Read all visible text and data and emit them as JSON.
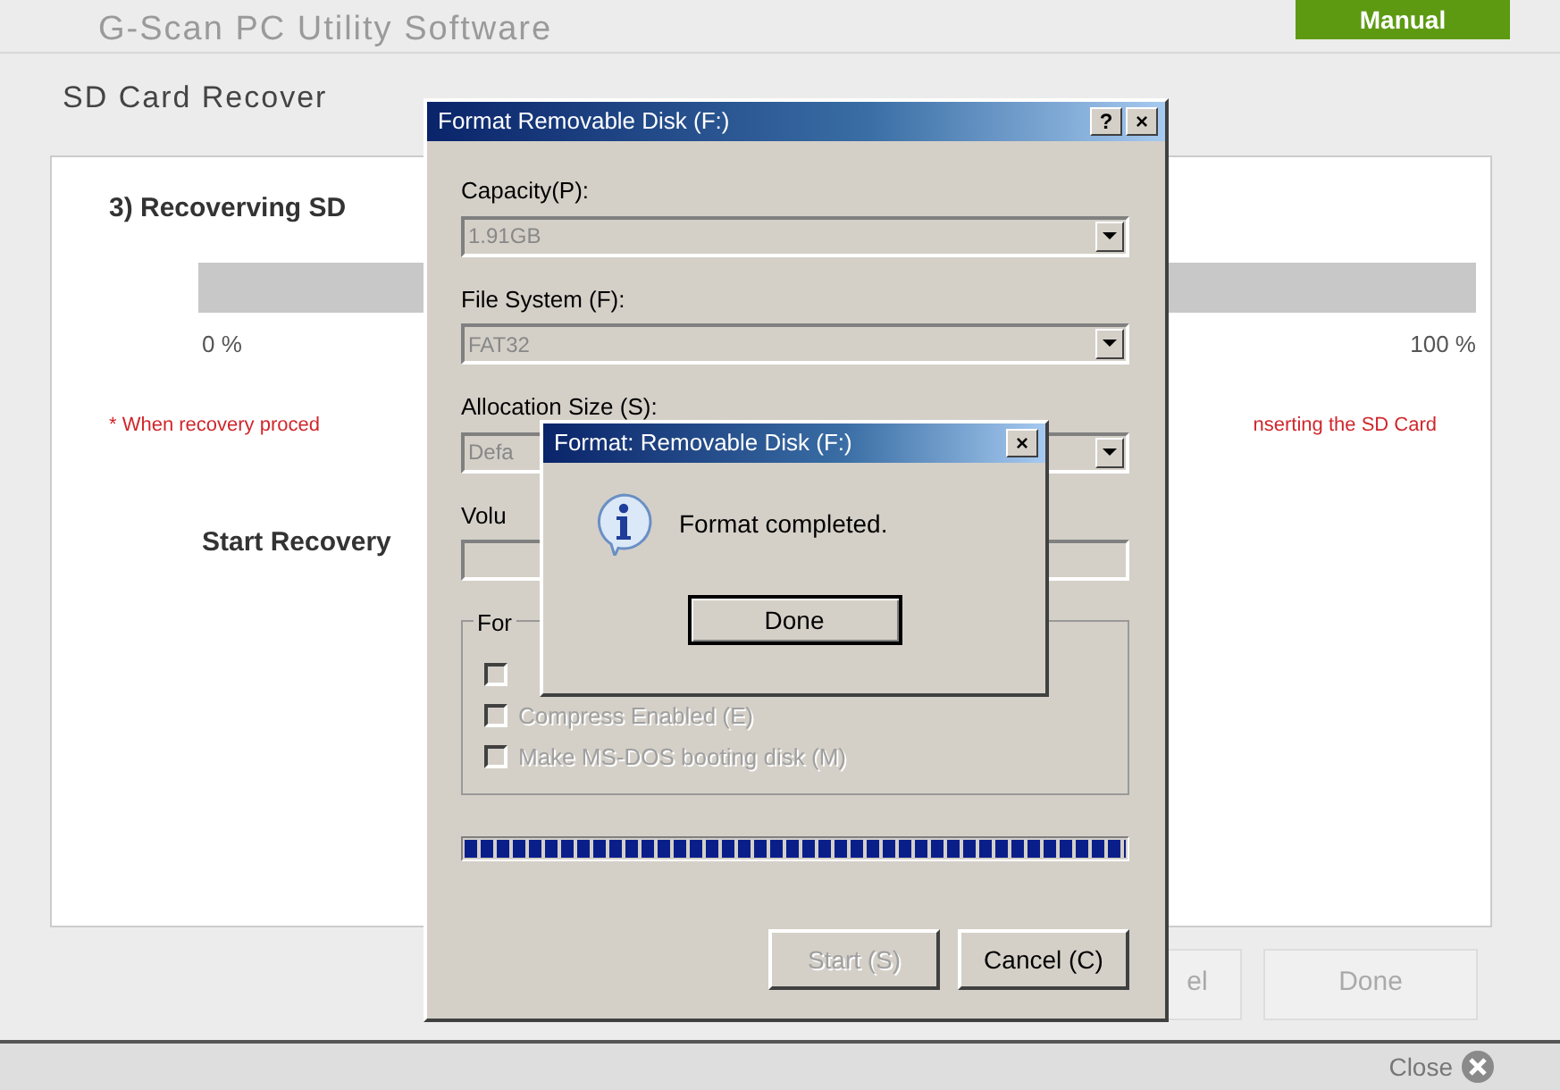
{
  "app": {
    "title": "G-Scan PC Utility Software",
    "manual_button": "Manual",
    "section_title": "SD Card Recover",
    "step_title": "3) Recoverving SD",
    "progress": {
      "level": 0,
      "start_label": "0 %",
      "end_label": "100 %"
    },
    "warning_left": "* When recovery proced",
    "warning_right": "nserting the SD Card",
    "start_recovery": "Start Recovery",
    "buttons": [
      {
        "label": "el",
        "disabled": true
      },
      {
        "label": "Done",
        "disabled": true
      }
    ],
    "close_label": "Close"
  },
  "format_dialog": {
    "title": "Format Removable Disk (F:)",
    "title_buttons": [
      "?",
      "×"
    ],
    "fields": [
      {
        "kind": "combo",
        "label": "Capacity(P):",
        "value": "1.91GB",
        "disabled": true
      },
      {
        "kind": "combo",
        "label": "File System (F):",
        "value": "FAT32",
        "disabled": true
      },
      {
        "kind": "combo",
        "label": "Allocation Size (S):",
        "value": "Defa",
        "disabled": true
      },
      {
        "kind": "text",
        "label": "Volu",
        "disabled": true
      }
    ],
    "group_label": "For",
    "options": [
      {
        "checked": false,
        "disabled": true
      },
      {
        "label": "Compress Enabled (E)",
        "checked": false,
        "disabled": true
      },
      {
        "label": "Make MS-DOS booting disk (M)",
        "checked": false,
        "disabled": true
      }
    ],
    "progress": {
      "level": 1
    },
    "buttons": [
      {
        "label": "Start (S)",
        "disabled": true
      },
      {
        "label": "Cancel (C)",
        "disabled": false
      }
    ]
  },
  "message_box": {
    "title": "Format: Removable Disk (F:)",
    "close": "×",
    "message": "Format completed.",
    "button": "Done"
  }
}
